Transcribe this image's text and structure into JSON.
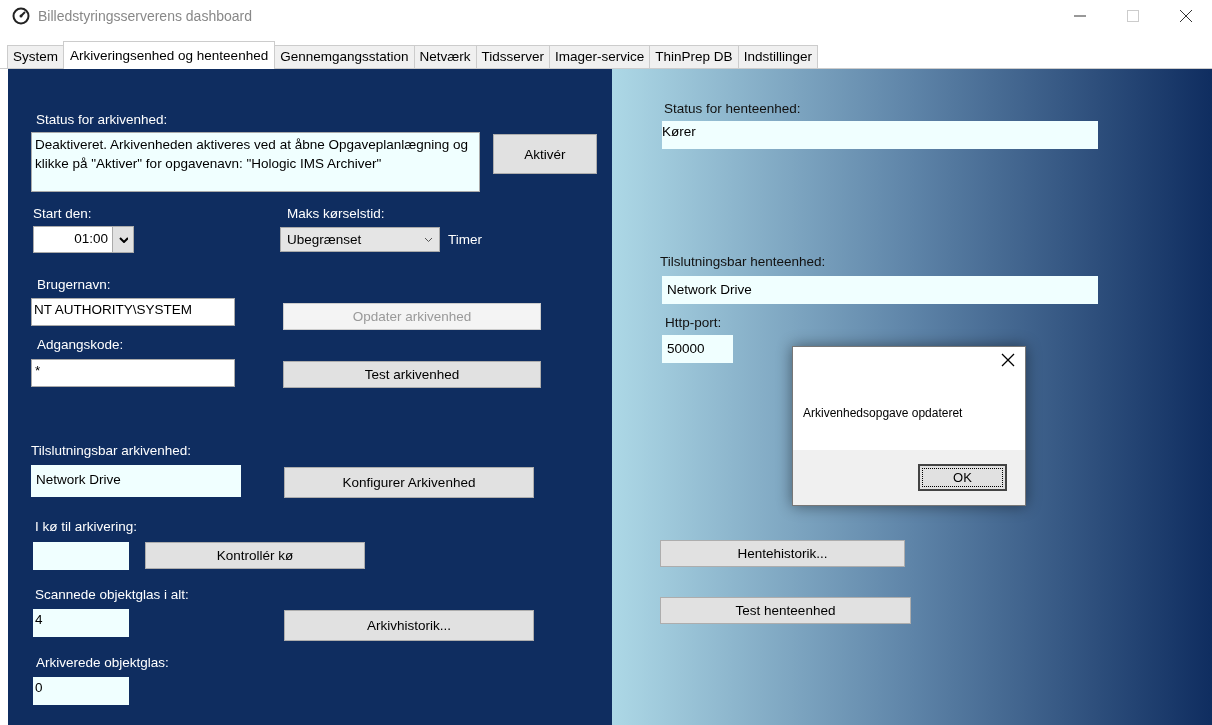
{
  "window": {
    "title": "Billedstyringsserverens dashboard"
  },
  "tabs": [
    {
      "label": "System",
      "selected": false
    },
    {
      "label": "Arkiveringsenhed og henteenhed",
      "selected": true
    },
    {
      "label": "Gennemgangsstation",
      "selected": false
    },
    {
      "label": "Netværk",
      "selected": false
    },
    {
      "label": "Tidsserver",
      "selected": false
    },
    {
      "label": "Imager-service",
      "selected": false
    },
    {
      "label": "ThinPrep DB",
      "selected": false
    },
    {
      "label": "Indstillinger",
      "selected": false
    }
  ],
  "archive": {
    "status_label": "Status for arkivenhed:",
    "status_value": "Deaktiveret. Arkivenheden aktiveres ved at åbne Opgaveplanlægning og klikke på \"Aktiver\" for opgavenavn: \"Hologic IMS Archiver\"",
    "activate_button": {
      "label": "Aktivér",
      "disabled": false
    },
    "start_label": "Start den:",
    "start_value": "01:00",
    "max_runtime_label": "Maks kørselstid:",
    "max_runtime_value": "Ubegrænset",
    "runtime_unit": "Timer",
    "username_label": "Brugernavn:",
    "username_value": "NT AUTHORITY\\SYSTEM",
    "update_button": {
      "label": "Opdater arkivenhed",
      "disabled": true
    },
    "password_label": "Adgangskode:",
    "password_value": "*",
    "test_button": {
      "label": "Test arkivenhed",
      "disabled": false
    },
    "connectable_label": "Tilslutningsbar arkivenhed:",
    "connectable_value": "Network Drive",
    "configure_button": {
      "label": "Konfigurer Arkivenhed",
      "disabled": false
    },
    "queue_label": "I kø til arkivering:",
    "check_queue_button": {
      "label": "Kontrollér kø",
      "disabled": false
    },
    "scanned_label": "Scannede objektglas i alt:",
    "scanned_value": "4",
    "history_button": {
      "label": "Arkivhistorik...",
      "disabled": false
    },
    "archived_label": "Arkiverede objektglas:",
    "archived_value": "0"
  },
  "retrieval": {
    "status_label": "Status for henteenhed:",
    "status_value": "Kører",
    "connectable_label": "Tilslutningsbar henteenhed:",
    "connectable_value": "Network Drive",
    "port_label": "Http-port:",
    "port_value": "50000",
    "history_button": {
      "label": "Hentehistorik...",
      "disabled": false
    },
    "test_button": {
      "label": "Test henteenhed",
      "disabled": false
    }
  },
  "dialog": {
    "message": "Arkivenhedsopgave opdateret",
    "ok_button": "OK"
  }
}
